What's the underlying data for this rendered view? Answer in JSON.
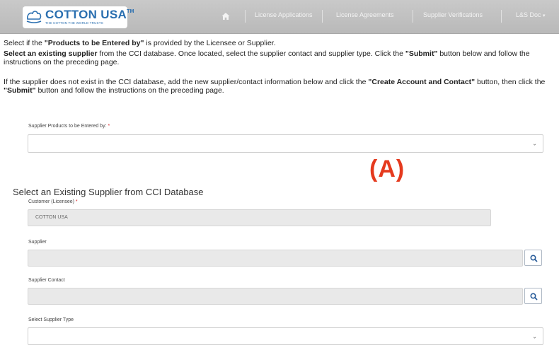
{
  "navbar": {
    "logo_text": "COTTON USA",
    "logo_tm": "TM",
    "logo_tagline": "THE COTTON THE WORLD TRUSTS",
    "items": [
      {
        "label": "License Applications"
      },
      {
        "label": "License Agreements"
      },
      {
        "label": "Supplier Verifications"
      },
      {
        "label": "L&S Doc"
      }
    ],
    "dropdown_caret": "▾",
    "colors": {
      "bar": "#c1c1c1",
      "logo_blue": "#2a6fb0"
    }
  },
  "instructions": {
    "p1_before": "Select if the ",
    "p1_bold": "\"Products to be Entered by\"",
    "p1_after": " is provided by the Licensee or Supplier.",
    "p2_bold1": "Select an existing supplier",
    "p2_mid": " from the CCI database.  Once located, select the supplier contact and supplier type. Click the ",
    "p2_bold2": "\"Submit\"",
    "p2_after": " button below and follow the instructions on the preceding page.",
    "p3_before": "If the supplier does not exist in the CCI database, add the new supplier/contact information below and click the ",
    "p3_bold1": "\"Create Account and Contact\"",
    "p3_mid": " button, then click the ",
    "p3_bold2": "\"Submit\"",
    "p3_after": " button and follow the instructions on the preceding page."
  },
  "form": {
    "products_entered_by": {
      "label": "Supplier Products to be Entered by: ",
      "required_mark": "*",
      "value": ""
    },
    "section_title": "Select an Existing Supplier from CCI Database",
    "customer": {
      "label": "Customer (Licensee) ",
      "required_mark": "*",
      "value": "COTTON USA"
    },
    "supplier": {
      "label": "Supplier",
      "value": ""
    },
    "supplier_contact": {
      "label": "Supplier Contact",
      "value": ""
    },
    "supplier_type": {
      "label": "Select Supplier Type",
      "value": ""
    },
    "caret": "⌄"
  },
  "annotation": {
    "text": "(A)",
    "color": "#e53a1e"
  },
  "icons": {
    "home": "home-icon",
    "search": "search-icon",
    "logo": "cotton-boll-icon"
  }
}
